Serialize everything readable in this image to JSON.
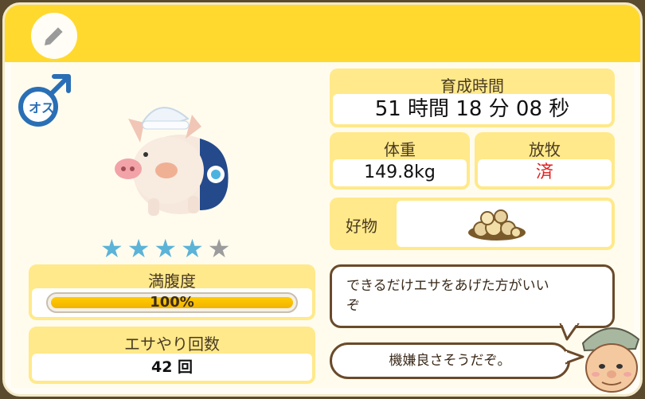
{
  "header": {
    "edit_icon": "pencil-icon"
  },
  "gender": {
    "symbol": "male-icon",
    "label": "オス",
    "color": "#2a6fb5"
  },
  "pet": {
    "image": "pig-with-headband"
  },
  "rating": {
    "value": 4,
    "max": 5,
    "filled_color": "#5bb3d8",
    "empty_color": "#9c9c9c"
  },
  "satiety": {
    "label": "満腹度",
    "percent": 100,
    "text": "100%"
  },
  "feeding": {
    "label": "エサやり回数",
    "value": "42 回"
  },
  "raising_time": {
    "label": "育成時間",
    "value": "51 時間 18 分 08 秒"
  },
  "weight": {
    "label": "体重",
    "value": "149.8kg"
  },
  "grazing": {
    "label": "放牧",
    "value": "済",
    "value_color": "#e02020"
  },
  "favorite": {
    "label": "好物",
    "item_icon": "feed-pile-icon"
  },
  "messages": [
    {
      "text1": "できるだけエサをあげた方がいい",
      "text2": "ぞ"
    },
    {
      "text1": "機嫌良さそうだぞ。"
    }
  ],
  "npc": {
    "image": "farmer-face"
  }
}
